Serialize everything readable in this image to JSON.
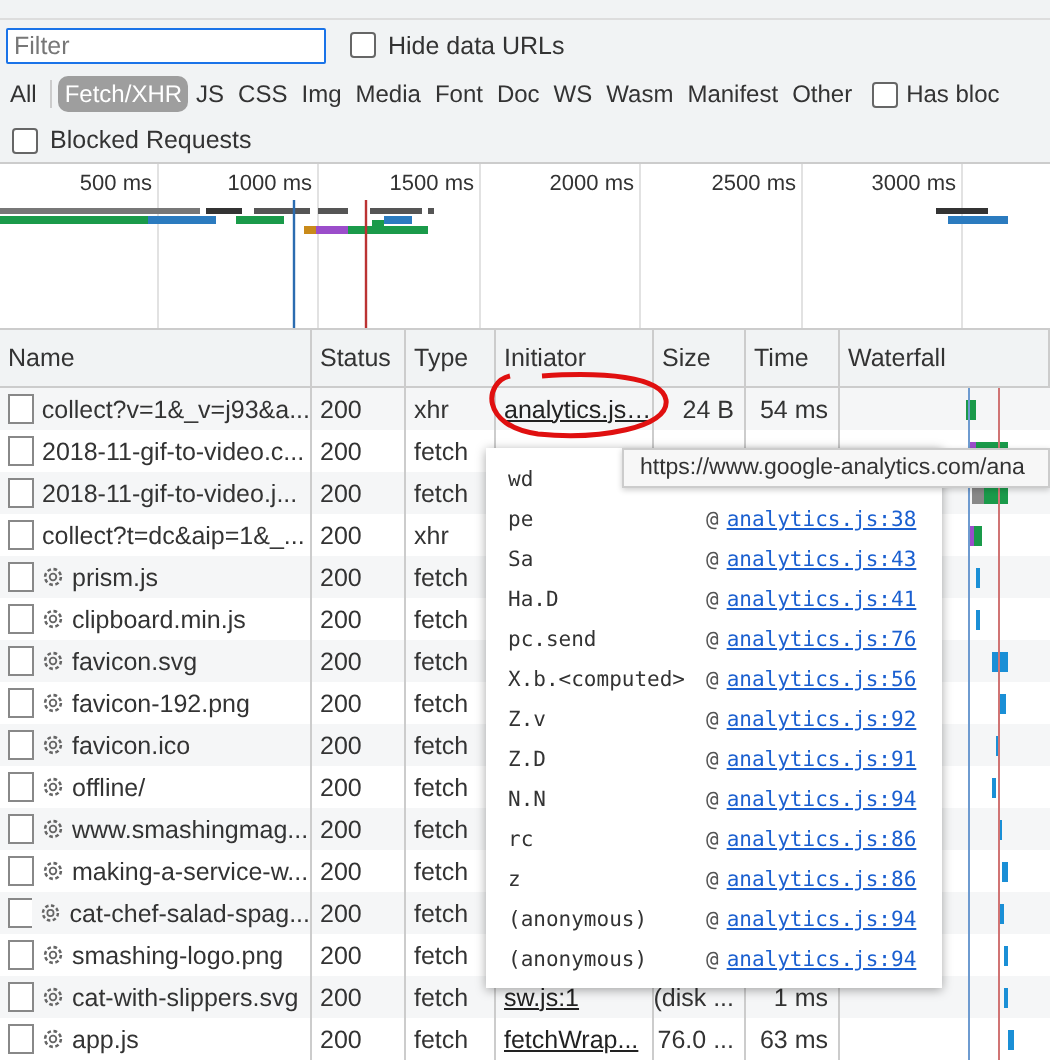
{
  "filter": {
    "placeholder": "Filter",
    "hide_data_urls": {
      "label": "Hide data URLs",
      "checked": false
    }
  },
  "type_filters": [
    {
      "label": "All",
      "selected": false
    },
    {
      "label": "Fetch/XHR",
      "selected": true
    },
    {
      "label": "JS",
      "selected": false
    },
    {
      "label": "CSS",
      "selected": false
    },
    {
      "label": "Img",
      "selected": false
    },
    {
      "label": "Media",
      "selected": false
    },
    {
      "label": "Font",
      "selected": false
    },
    {
      "label": "Doc",
      "selected": false
    },
    {
      "label": "WS",
      "selected": false
    },
    {
      "label": "Wasm",
      "selected": false
    },
    {
      "label": "Manifest",
      "selected": false
    },
    {
      "label": "Other",
      "selected": false
    }
  ],
  "has_blocked": {
    "label": "Has bloc",
    "checked": false
  },
  "blocked_requests": {
    "label": "Blocked Requests",
    "checked": false
  },
  "overview": {
    "ticks": [
      "500 ms",
      "1000 ms",
      "1500 ms",
      "2000 ms",
      "2500 ms",
      "3000 ms"
    ]
  },
  "table": {
    "columns": [
      "Name",
      "Status",
      "Type",
      "Initiator",
      "Size",
      "Time",
      "Waterfall"
    ],
    "rows": [
      {
        "name": "collect?v=1&_v=j93&a...",
        "status": "200",
        "type": "xhr",
        "initiator": "analytics.js…",
        "size": "24 B",
        "time": "54 ms",
        "service_worker": false
      },
      {
        "name": "2018-11-gif-to-video.c...",
        "status": "200",
        "type": "fetch",
        "service_worker": false
      },
      {
        "name": "2018-11-gif-to-video.j...",
        "status": "200",
        "type": "fetch",
        "service_worker": false
      },
      {
        "name": "collect?t=dc&aip=1&_...",
        "status": "200",
        "type": "xhr",
        "service_worker": false
      },
      {
        "name": "prism.js",
        "status": "200",
        "type": "fetch",
        "service_worker": true
      },
      {
        "name": "clipboard.min.js",
        "status": "200",
        "type": "fetch",
        "service_worker": true
      },
      {
        "name": "favicon.svg",
        "status": "200",
        "type": "fetch",
        "service_worker": true
      },
      {
        "name": "favicon-192.png",
        "status": "200",
        "type": "fetch",
        "service_worker": true
      },
      {
        "name": "favicon.ico",
        "status": "200",
        "type": "fetch",
        "service_worker": true
      },
      {
        "name": "offline/",
        "status": "200",
        "type": "fetch",
        "service_worker": true
      },
      {
        "name": "www.smashingmag...",
        "status": "200",
        "type": "fetch",
        "service_worker": true
      },
      {
        "name": "making-a-service-w...",
        "status": "200",
        "type": "fetch",
        "service_worker": true
      },
      {
        "name": "cat-chef-salad-spag...",
        "status": "200",
        "type": "fetch",
        "service_worker": true
      },
      {
        "name": "smashing-logo.png",
        "status": "200",
        "type": "fetch",
        "service_worker": true
      },
      {
        "name": "cat-with-slippers.svg",
        "status": "200",
        "type": "fetch",
        "initiator": "sw.js:1",
        "size": "(disk ...",
        "time": "1 ms",
        "service_worker": true
      },
      {
        "name": "app.js",
        "status": "200",
        "type": "fetch",
        "initiator": "fetchWrap...",
        "size": "76.0 ...",
        "time": "63 ms",
        "service_worker": true
      }
    ]
  },
  "initiator_popup": {
    "stack": [
      {
        "fn": "wd"
      },
      {
        "fn": "pe",
        "at": "@",
        "link": "analytics.js:38"
      },
      {
        "fn": "Sa",
        "at": "@",
        "link": "analytics.js:43"
      },
      {
        "fn": "Ha.D",
        "at": "@",
        "link": "analytics.js:41"
      },
      {
        "fn": "pc.send",
        "at": "@",
        "link": "analytics.js:76"
      },
      {
        "fn": "X.b.<computed>",
        "at": "@",
        "link": "analytics.js:56"
      },
      {
        "fn": "Z.v",
        "at": "@",
        "link": "analytics.js:92"
      },
      {
        "fn": "Z.D",
        "at": "@",
        "link": "analytics.js:91"
      },
      {
        "fn": "N.N",
        "at": "@",
        "link": "analytics.js:94"
      },
      {
        "fn": "rc",
        "at": "@",
        "link": "analytics.js:86"
      },
      {
        "fn": "z",
        "at": "@",
        "link": "analytics.js:86"
      },
      {
        "fn": "(anonymous)",
        "at": "@",
        "link": "analytics.js:94"
      },
      {
        "fn": "(anonymous)",
        "at": "@",
        "link": "analytics.js:94"
      }
    ]
  },
  "tooltip": {
    "text": "https://www.google-analytics.com/ana"
  }
}
